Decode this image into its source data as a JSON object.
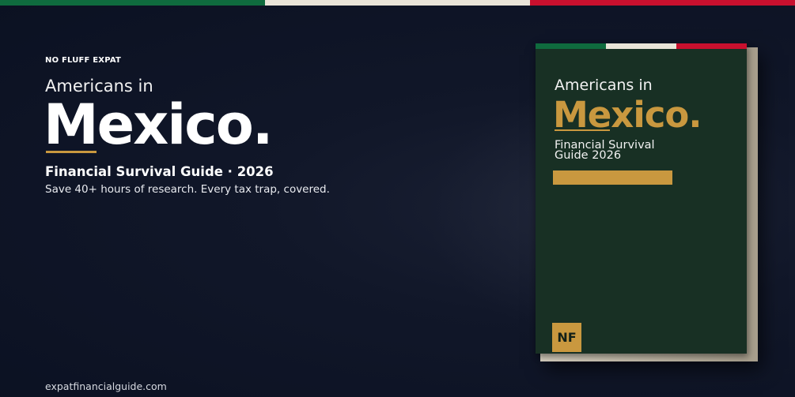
{
  "colors": {
    "flag_green": "#0f6b3e",
    "flag_white": "#e9e4d8",
    "flag_red": "#c8102e",
    "accent_gold": "#c9983f",
    "background": "#0f1528",
    "cover_green": "#183024"
  },
  "hero": {
    "kicker": "NO FLUFF EXPAT",
    "lead": "Americans in",
    "headline": "Mexico.",
    "subtitle": "Financial Survival Guide · 2026",
    "tagline": "Save 40+ hours of research. Every tax trap, covered."
  },
  "footer": {
    "url": "expatfinancialguide.com"
  },
  "book": {
    "lead": "Americans in",
    "title": "Mexico.",
    "subtitle": "Financial Survival Guide 2026",
    "badge": "NF"
  }
}
